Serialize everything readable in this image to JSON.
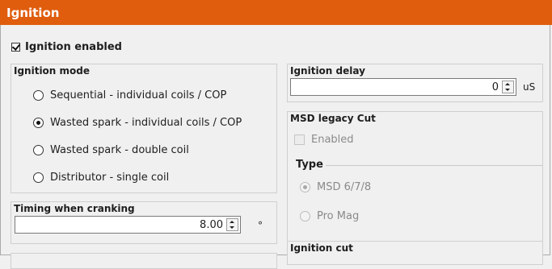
{
  "header": {
    "title": "Ignition"
  },
  "ignition_enabled": {
    "label": "Ignition enabled",
    "checked": true
  },
  "ignition_mode": {
    "title": "Ignition mode",
    "options": [
      {
        "label": "Sequential - individual coils / COP",
        "selected": false
      },
      {
        "label": "Wasted spark - individual coils / COP",
        "selected": true
      },
      {
        "label": "Wasted spark - double coil",
        "selected": false
      },
      {
        "label": "Distributor - single coil",
        "selected": false
      }
    ]
  },
  "timing_cranking": {
    "title": "Timing when cranking",
    "value": "8.00",
    "unit": "°"
  },
  "ignition_delay": {
    "title": "Ignition delay",
    "value": "0",
    "unit": "uS"
  },
  "msd_legacy_cut": {
    "title": "MSD legacy Cut",
    "enabled_label": "Enabled",
    "enabled_checked": false,
    "type_label": "Type",
    "options": [
      {
        "label": "MSD 6/7/8",
        "selected": true
      },
      {
        "label": "Pro Mag",
        "selected": false
      }
    ]
  },
  "ignition_cut": {
    "title": "Ignition cut"
  },
  "colors": {
    "header_bg": "#e05d0e",
    "header_text": "#ffffff"
  }
}
